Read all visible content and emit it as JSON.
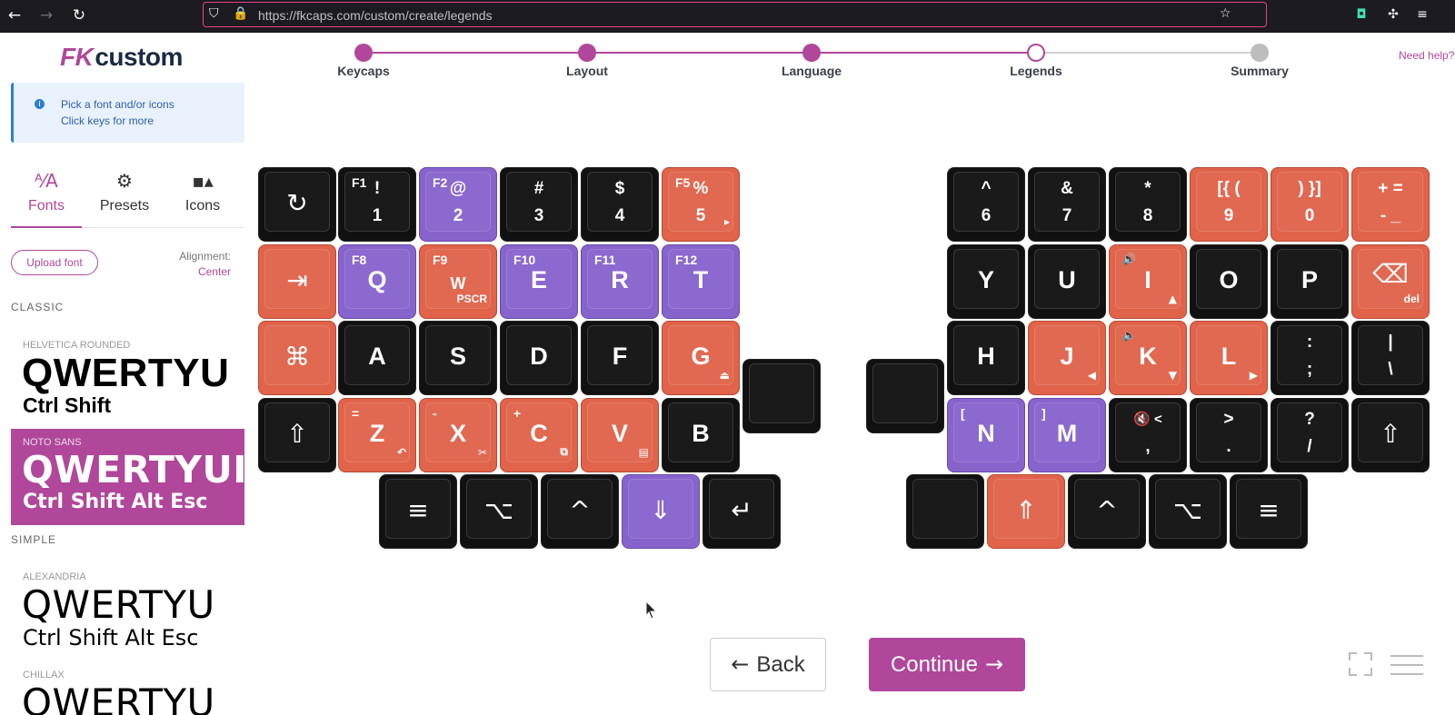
{
  "browser": {
    "url": "https://fkcaps.com/custom/create/legends",
    "icons": [
      "back-icon",
      "forward-icon",
      "reload-icon",
      "shield-icon",
      "lock-icon",
      "star-icon",
      "pocket-icon",
      "extensions-icon"
    ]
  },
  "logo": {
    "mark": "FK",
    "text": "custom"
  },
  "stepper": {
    "steps": [
      {
        "label": "Keycaps",
        "state": "done"
      },
      {
        "label": "Layout",
        "state": "done"
      },
      {
        "label": "Language",
        "state": "done"
      },
      {
        "label": "Legends",
        "state": "current"
      },
      {
        "label": "Summary",
        "state": "pending"
      }
    ],
    "need_help": "Need help?"
  },
  "colors": {
    "accent": "#b0479a",
    "key_black": "#111111",
    "key_red": "#e0634a",
    "key_purple": "#8763cc",
    "info_blue": "#2b7ddb"
  },
  "info": {
    "line1": "Pick a font and/or icons",
    "line2": "Click keys for more"
  },
  "tabs": [
    {
      "label": "Fonts",
      "icon": "font-icon",
      "glyph": "ᴬ⁄A",
      "active": true
    },
    {
      "label": "Presets",
      "icon": "gear-icon",
      "glyph": "⚙",
      "active": false
    },
    {
      "label": "Icons",
      "icon": "shapes-icon",
      "glyph": "▪▴",
      "active": false
    }
  ],
  "upload_font": "Upload font",
  "alignment": {
    "label": "Alignment:",
    "value": "Center"
  },
  "sections": {
    "classic": "CLASSIC",
    "simple": "SIMPLE"
  },
  "fonts": [
    {
      "name": "HELVETICA ROUNDED",
      "big": "QWERTYU",
      "small": "Ctrl Shift"
    },
    {
      "name": "NOTO SANS",
      "big": "QWERTYUI",
      "small": "Ctrl Shift Alt Esc",
      "selected": true
    },
    {
      "name": "ALEXANDRIA",
      "big": "QWERTYU",
      "small": "Ctrl Shift Alt Esc"
    },
    {
      "name": "CHILLAX",
      "big": "QWERTYU",
      "small": ""
    }
  ],
  "keys": {
    "l_esc": {
      "icon": "↻",
      "name": "reset-icon"
    },
    "l_1": {
      "top": "!",
      "bot": "1",
      "tl": "F1"
    },
    "l_2": {
      "top": "@",
      "bot": "2",
      "tl": "F2"
    },
    "l_3": {
      "top": "#",
      "bot": "3"
    },
    "l_4": {
      "top": "$",
      "bot": "4"
    },
    "l_5": {
      "top": "%",
      "bot": "5",
      "tl": "F5",
      "br": "▸"
    },
    "l_tab": {
      "icon": "⇥",
      "name": "tab-icon"
    },
    "l_q": {
      "main": "Q",
      "tl": "F8"
    },
    "l_w": {
      "main": "W",
      "tl": "F9",
      "br": "PSCR"
    },
    "l_e": {
      "main": "E",
      "tl": "F10"
    },
    "l_r": {
      "main": "R",
      "tl": "F11"
    },
    "l_t": {
      "main": "T",
      "tl": "F12"
    },
    "l_cmd": {
      "icon": "⌘",
      "name": "command-icon"
    },
    "l_a": {
      "main": "A"
    },
    "l_s": {
      "main": "S"
    },
    "l_d": {
      "main": "D"
    },
    "l_f": {
      "main": "F"
    },
    "l_g": {
      "main": "G",
      "br": "⏏"
    },
    "l_shift": {
      "icon": "⇧",
      "name": "shift-icon"
    },
    "l_z": {
      "main": "Z",
      "tl": "=",
      "br": "↶"
    },
    "l_x": {
      "main": "X",
      "tl": "-",
      "br": "✂"
    },
    "l_c": {
      "main": "C",
      "tl": "+",
      "br": "⧉"
    },
    "l_v": {
      "main": "V",
      "br": "▤"
    },
    "l_b": {
      "main": "B"
    },
    "l_menu": {
      "icon": "≡",
      "name": "menu-icon"
    },
    "l_opt": {
      "icon": "⌥",
      "name": "option-icon"
    },
    "l_ctrl": {
      "icon": "^",
      "name": "control-icon"
    },
    "l_down": {
      "icon": "⇓",
      "name": "layer-down-icon"
    },
    "l_enter": {
      "icon": "↵",
      "name": "enter-icon"
    },
    "r_6": {
      "top": "^",
      "bot": "6"
    },
    "r_7": {
      "top": "&",
      "bot": "7"
    },
    "r_8": {
      "top": "*",
      "bot": "8"
    },
    "r_9": {
      "top": "[{ (",
      "bot": "9"
    },
    "r_0": {
      "top": ") }]",
      "bot": "0"
    },
    "r_eq": {
      "top": "+ =",
      "bot": "- _"
    },
    "r_y": {
      "main": "Y"
    },
    "r_u": {
      "main": "U"
    },
    "r_i": {
      "main": "I",
      "tl": "🔊",
      "br": "▲"
    },
    "r_o": {
      "main": "O"
    },
    "r_p": {
      "main": "P"
    },
    "r_del": {
      "icon": "⌫",
      "name": "backspace-icon",
      "br": "del"
    },
    "r_h": {
      "main": "H"
    },
    "r_j": {
      "main": "J",
      "br": "◀"
    },
    "r_k": {
      "main": "K",
      "tl": "🔈",
      "br": "▼"
    },
    "r_l": {
      "main": "L",
      "br": "▶"
    },
    "r_semi": {
      "top": ":",
      "bot": ";"
    },
    "r_pipe": {
      "top": "|",
      "bot": "\\"
    },
    "r_n": {
      "main": "N",
      "tl": "["
    },
    "r_m": {
      "main": "M",
      "tl": "]"
    },
    "r_comma": {
      "top": "🔇 <",
      "bot": ","
    },
    "r_dot": {
      "top": ">",
      "bot": "."
    },
    "r_slash": {
      "top": "?",
      "bot": "/"
    },
    "r_shift": {
      "icon": "⇧",
      "name": "shift-icon"
    },
    "r_up": {
      "icon": "⇑",
      "name": "layer-up-icon"
    },
    "r_ctrl": {
      "icon": "^",
      "name": "control-icon"
    },
    "r_opt": {
      "icon": "⌥",
      "name": "option-icon"
    },
    "r_menu": {
      "icon": "≡",
      "name": "menu-icon"
    }
  },
  "buttons": {
    "back": "Back",
    "continue": "Continue"
  }
}
